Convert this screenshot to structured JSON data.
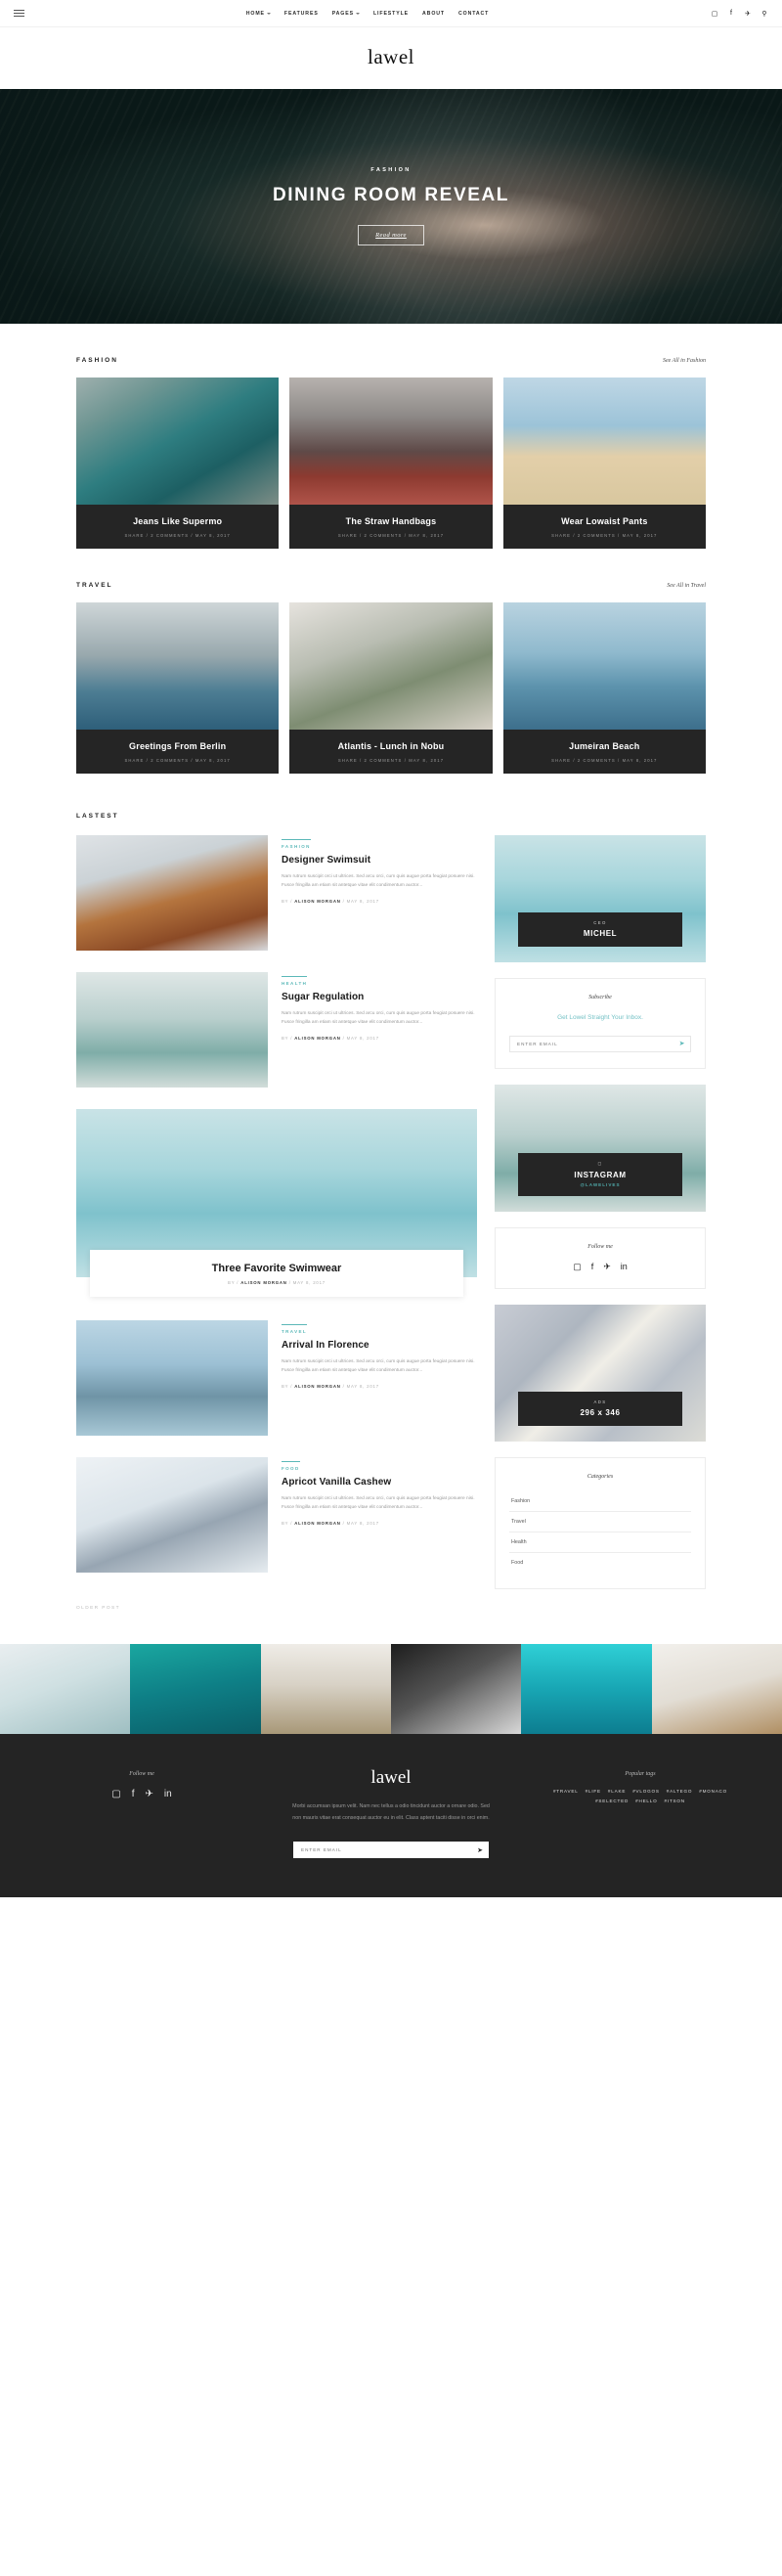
{
  "topbar": {
    "menu_icon": "hamburger-icon",
    "nav": [
      {
        "label": "HOME",
        "caret": true
      },
      {
        "label": "FEATURES",
        "caret": false
      },
      {
        "label": "PAGES",
        "caret": true
      },
      {
        "label": "LIFESTYLE",
        "caret": false
      },
      {
        "label": "ABOUT",
        "caret": false
      },
      {
        "label": "CONTACT",
        "caret": false
      }
    ],
    "social": [
      "instagram-icon",
      "facebook-icon",
      "twitter-icon",
      "search-icon"
    ],
    "social_glyphs": [
      "▢",
      "f",
      "✈",
      "⚲"
    ]
  },
  "brand": {
    "logo": "lawel"
  },
  "hero": {
    "category": "FASHION",
    "title": "DINING ROOM REVEAL",
    "button": "Read more"
  },
  "sections": [
    {
      "title": "FASHION",
      "link": "See All in Fashion",
      "cards": [
        {
          "title": "Jeans Like Supermo",
          "meta": "SHARE  /  2 COMMENTS  /  MAY 8, 2017",
          "img": "ph-door"
        },
        {
          "title": "The Straw Handbags",
          "meta": "SHARE  /  2 COMMENTS  /  MAY 8, 2017",
          "img": "ph-laundry"
        },
        {
          "title": "Wear Lowaist Pants",
          "meta": "SHARE  /  2 COMMENTS  /  MAY 8, 2017",
          "img": "ph-beach"
        }
      ]
    },
    {
      "title": "TRAVEL",
      "link": "See All in Travel",
      "cards": [
        {
          "title": "Greetings From Berlin",
          "meta": "SHARE  /  2 COMMENTS  /  MAY 8, 2017",
          "img": "ph-berlin"
        },
        {
          "title": "Atlantis - Lunch in Nobu",
          "meta": "SHARE  /  2 COMMENTS  /  MAY 8, 2017",
          "img": "ph-nobu"
        },
        {
          "title": "Jumeiran Beach",
          "meta": "SHARE  /  2 COMMENTS  /  MAY 8, 2017",
          "img": "ph-jumeiran"
        }
      ]
    }
  ],
  "latest": {
    "title": "LASTEST",
    "older_link": "OLDER POST",
    "excerpt": "Nam rutrum suscipit orci ut ultrices. Sed arcu orci, cum quis augue porta feugiat posuere nisi. Fusce fringilla am etiam sit antetque vitae elit condimentum auctor...",
    "posts": [
      {
        "category": "FASHION",
        "title": "Designer Swimsuit",
        "author": "ALISON MORGAN",
        "date": "May 8, 2017",
        "img": "ph-hair"
      },
      {
        "category": "HEALTH",
        "title": "Sugar Regulation",
        "author": "ALISON MORGAN",
        "date": "May 8, 2017",
        "img": "ph-tower"
      },
      {
        "category": "TRAVEL",
        "title": "Arrival In Florence",
        "author": "ALISON MORGAN",
        "date": "May 8, 2017",
        "img": "ph-pier"
      },
      {
        "category": "FOOD",
        "title": "Apricot Vanilla Cashew",
        "author": "ALISON MORGAN",
        "date": "May 8, 2017",
        "img": "ph-jump"
      }
    ],
    "feature": {
      "title": "Three Favorite Swimwear",
      "author": "ALISON MORGAN",
      "date": "May 8, 2017",
      "img": "ph-sea"
    },
    "by_prefix": "By",
    "sep": "/"
  },
  "sidebar": {
    "author_widget": {
      "sub": "CEO",
      "name": "MICHEL"
    },
    "subscribe": {
      "title": "Subscribe",
      "text": "Get Lowel Straight Your Inbox.",
      "placeholder": "ENTER EMAIL",
      "submit_glyph": "➤"
    },
    "instagram": {
      "icon": "instagram-icon",
      "label": "INSTAGRAM",
      "handle": "@LAWELIVES"
    },
    "follow": {
      "title": "Follow me",
      "social": [
        "instagram-icon",
        "facebook-icon",
        "twitter-icon",
        "linkedin-icon"
      ],
      "glyphs": [
        "▢",
        "f",
        "✈",
        "in"
      ]
    },
    "ads": {
      "sub": "ADS",
      "size": "296 x 346"
    },
    "categories": {
      "title": "Categories",
      "items": [
        "Fashion",
        "Travel",
        "Health",
        "Food"
      ]
    }
  },
  "footer": {
    "follow_title": "Follow me",
    "follow_social": [
      "instagram-icon",
      "facebook-icon",
      "twitter-icon",
      "linkedin-icon"
    ],
    "follow_glyphs": [
      "▢",
      "f",
      "✈",
      "in"
    ],
    "logo": "lawel",
    "description": "Morbi accumsan ipsum velit. Nam nec tellus a odio tincidunt auctor a ornare odio. Sed non mauris vitae erat consequat auctor eu in elit. Class aptent taciti disse in orci enim.",
    "mail_placeholder": "ENTER EMAIL",
    "mail_glyph": "➤",
    "tags_title": "Popular tags",
    "tags": [
      "#TRAVEL",
      "#LIFE",
      "#LAKE",
      "#VLOGOS",
      "#ALTEGO",
      "#MONACO",
      "#SELECTED",
      "#HELLO",
      "#ITSON"
    ]
  },
  "colors": {
    "accent": "#5bb8b8",
    "dark": "#242424",
    "card_dark": "#252525"
  }
}
